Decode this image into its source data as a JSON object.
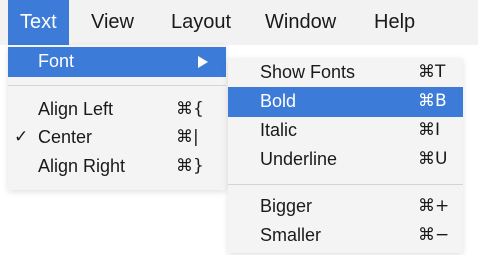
{
  "menubar": {
    "items": [
      {
        "label": "Text",
        "active": true
      },
      {
        "label": "View",
        "active": false
      },
      {
        "label": "Layout",
        "active": false
      },
      {
        "label": "Window",
        "active": false
      },
      {
        "label": "Help",
        "active": false
      }
    ]
  },
  "text_menu": {
    "font": {
      "label": "Font"
    },
    "align_left": {
      "label": "Align Left",
      "shortcut": "⌘{"
    },
    "center": {
      "label": "Center",
      "shortcut": "⌘|",
      "check": "✓"
    },
    "align_right": {
      "label": "Align Right",
      "shortcut": "⌘}"
    }
  },
  "font_submenu": {
    "show_fonts": {
      "label": "Show Fonts",
      "shortcut": "⌘T"
    },
    "bold": {
      "label": "Bold",
      "shortcut": "⌘B",
      "highlighted": true
    },
    "italic": {
      "label": "Italic",
      "shortcut": "⌘I"
    },
    "underline": {
      "label": "Underline",
      "shortcut": "⌘U"
    },
    "bigger": {
      "label": "Bigger",
      "shortcut": "⌘+"
    },
    "smaller": {
      "label": "Smaller",
      "shortcut": "⌘−"
    }
  },
  "colors": {
    "highlight": "#3d7bd8",
    "menu_background": "#f4f4f4",
    "menubar_background": "#f2f2f2"
  },
  "icons": {
    "submenu_arrow": "submenu-arrow-icon",
    "checkmark": "checkmark-icon"
  }
}
